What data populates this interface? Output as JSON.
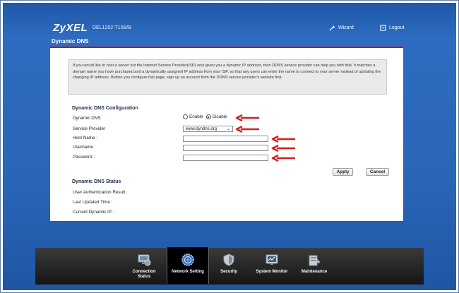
{
  "header": {
    "brand": "ZyXEL",
    "model": "DEL1202-T10B/B",
    "wizard_label": "Wizard",
    "logout_label": "Logout"
  },
  "page_title": "Dynamic DNS",
  "info_text": "If you would like to host a server but the Internet Service Provider(ISP) only gives you a dynamic IP address, then DDNS service provider can help you with that. It matches a domain name you have purchased and a dynamically assigned IP address from your ISP, so that any users can enter the name to connect to your server instead of updating the changing IP address. Before you configure this page, sign up an account from the DDNS service provider's website first.",
  "config": {
    "title": "Dynamic DNS Configuration",
    "dynamic_dns_label": "Dynamic DNS",
    "enable_label": "Enable",
    "disable_label": "Disable",
    "selected": "Disable",
    "service_provider_label": "Service Provider",
    "service_provider_value": "www.dyndns.org",
    "host_name_label": "Host Name :",
    "host_name_value": "",
    "username_label": "Username :",
    "username_value": "",
    "password_label": "Password :",
    "password_value": ""
  },
  "buttons": {
    "apply": "Apply",
    "cancel": "Cancel"
  },
  "status": {
    "title": "Dynamic DNS Status",
    "user_auth_label": "User Authentication Result :",
    "last_updated_label": "Last Updated Time :",
    "current_ip_label": "Current Dynamic IP :"
  },
  "nav": [
    {
      "label": "Connection\nStatus",
      "icon": "monitor-icon",
      "active": false
    },
    {
      "label": "Network Setting",
      "icon": "globe-gear-icon",
      "active": true
    },
    {
      "label": "Security",
      "icon": "shield-icon",
      "active": false
    },
    {
      "label": "System Monitor",
      "icon": "chart-monitor-icon",
      "active": false
    },
    {
      "label": "Maintenance",
      "icon": "toolbox-icon",
      "active": false
    }
  ],
  "colors": {
    "background_blue": "#2a66b8",
    "accent_red": "#c8102e",
    "arrow_red": "#d81e1e"
  }
}
